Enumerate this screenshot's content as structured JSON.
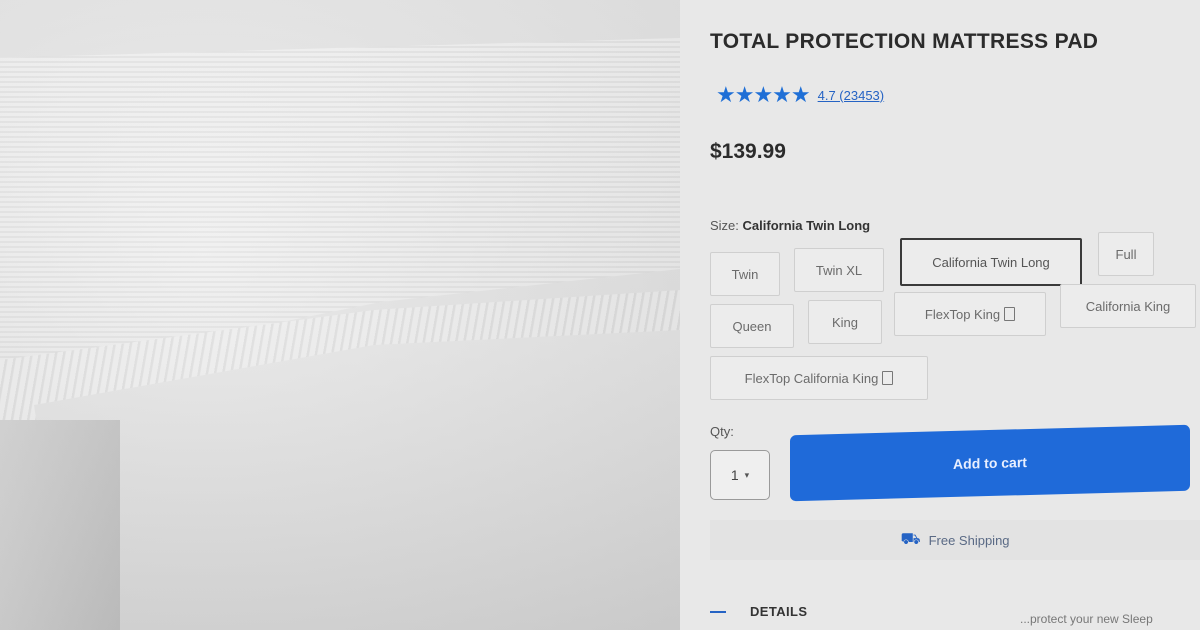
{
  "product": {
    "title": "TOTAL PROTECTION MATTRESS PAD",
    "stars": "★★★★★",
    "rating_text": "4.7 (23453)",
    "price": "$139.99"
  },
  "size": {
    "label": "Size:",
    "selected_value": "California Twin Long",
    "options": [
      "Twin",
      "Twin XL",
      "California Twin Long",
      "Full",
      "Queen",
      "King",
      "FlexTop King",
      "California King",
      "FlexTop California King"
    ]
  },
  "quantity": {
    "label": "Qty:",
    "value": "1"
  },
  "cart": {
    "add_label": "Add to cart"
  },
  "shipping": {
    "label": "Free Shipping",
    "icon": "truck-icon"
  },
  "details": {
    "label": "DETAILS",
    "snippet": "...protect your new Sleep"
  },
  "colors": {
    "accent": "#1f6ad9",
    "star": "#1f6fd6",
    "panel": "#e8e8e8"
  }
}
